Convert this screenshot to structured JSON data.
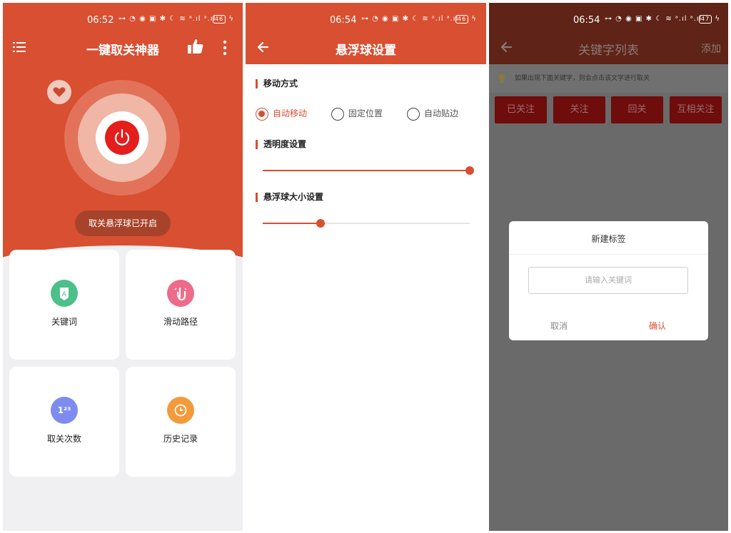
{
  "status_bars": [
    {
      "time": "06:52",
      "icons": "⊶ ◔ ◉ ▣ ✱ ☾ ≋ ᵃ.ıl ᵃ.ıl",
      "battery": "46"
    },
    {
      "time": "06:54",
      "icons": "⊶ ◔ ◉ ▣ ✱ ☾ ≋ ᵃ.ıl ᵃ.ıl",
      "battery": "46"
    },
    {
      "time": "06:54",
      "icons": "⊶ ◔ ◉ ▣ ✱ ☾ ≋ ᵃ.ıl ᵃ.ıl",
      "battery": "47"
    }
  ],
  "home": {
    "title": "一键取关神器",
    "status_pill": "取关悬浮球已开启",
    "cards": [
      {
        "label": "关键词",
        "icon": "keyword-icon",
        "color": "#4cc08a"
      },
      {
        "label": "滑动路径",
        "icon": "swipe-icon",
        "color": "#ee6b8b"
      },
      {
        "label": "取关次数",
        "icon": "counter-icon",
        "color": "#7e8cf0",
        "icon_text": "1²³"
      },
      {
        "label": "历史记录",
        "icon": "clock-icon",
        "color": "#f39a3a"
      }
    ]
  },
  "floating_settings": {
    "title": "悬浮球设置",
    "move_section": "移动方式",
    "move_options": [
      "自动移动",
      "固定位置",
      "自动贴边"
    ],
    "selected_move": 0,
    "opacity_section": "透明度设置",
    "opacity_value": 1.0,
    "size_section": "悬浮球大小设置",
    "size_value": 0.28
  },
  "keyword_list": {
    "title": "关键字列表",
    "add_label": "添加",
    "tip": "如果出现下面关键字，则会点击该文字进行取关",
    "tags": [
      "已关注",
      "关注",
      "回关",
      "互相关注"
    ],
    "dialog": {
      "title": "新建标签",
      "placeholder": "请输入关键词",
      "cancel": "取消",
      "confirm": "确认"
    }
  }
}
